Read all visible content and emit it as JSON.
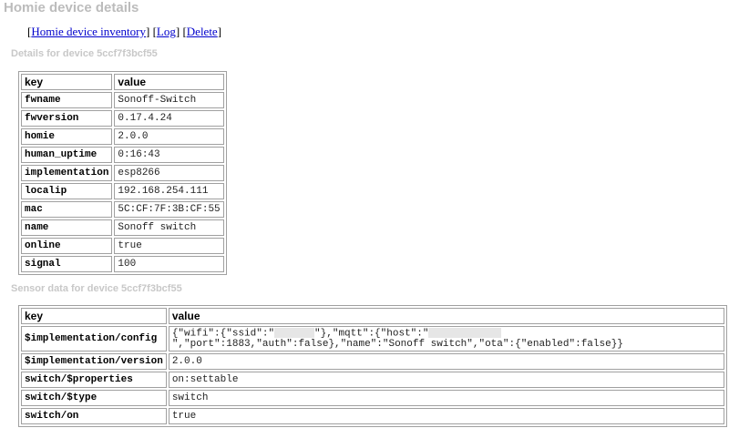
{
  "page": {
    "title": "Homie device details"
  },
  "nav": {
    "open": "[",
    "inventory": "Homie device inventory",
    "sep1": "] [",
    "log": "Log",
    "sep2": "] [",
    "delete": "Delete",
    "close": "]"
  },
  "details": {
    "heading": "Details for device 5ccf7f3bcf55",
    "col_key": "key",
    "col_value": "value",
    "rows": [
      {
        "key": "fwname",
        "value": "Sonoff-Switch"
      },
      {
        "key": "fwversion",
        "value": "0.17.4.24"
      },
      {
        "key": "homie",
        "value": "2.0.0"
      },
      {
        "key": "human_uptime",
        "value": "0:16:43"
      },
      {
        "key": "implementation",
        "value": "esp8266"
      },
      {
        "key": "localip",
        "value": "192.168.254.111"
      },
      {
        "key": "mac",
        "value": "5C:CF:7F:3B:CF:55"
      },
      {
        "key": "name",
        "value": "Sonoff switch"
      },
      {
        "key": "online",
        "value": "true"
      },
      {
        "key": "signal",
        "value": "100"
      }
    ]
  },
  "sensor": {
    "heading": "Sensor data for device 5ccf7f3bcf55",
    "col_key": "key",
    "col_value": "value",
    "config": {
      "key": "$implementation/config",
      "part1": "{\"wifi\":{\"ssid\":\"",
      "part2": "\"},\"mqtt\":{\"host\":\"",
      "part3": "\",\"port\":1883,\"auth\":false},\"name\":\"Sonoff switch\",\"ota\":{\"enabled\":false}}"
    },
    "rows": [
      {
        "key": "$implementation/version",
        "value": "2.0.0"
      },
      {
        "key": "switch/$properties",
        "value": "on:settable"
      },
      {
        "key": "switch/$type",
        "value": "switch"
      },
      {
        "key": "switch/on",
        "value": "true"
      }
    ]
  }
}
